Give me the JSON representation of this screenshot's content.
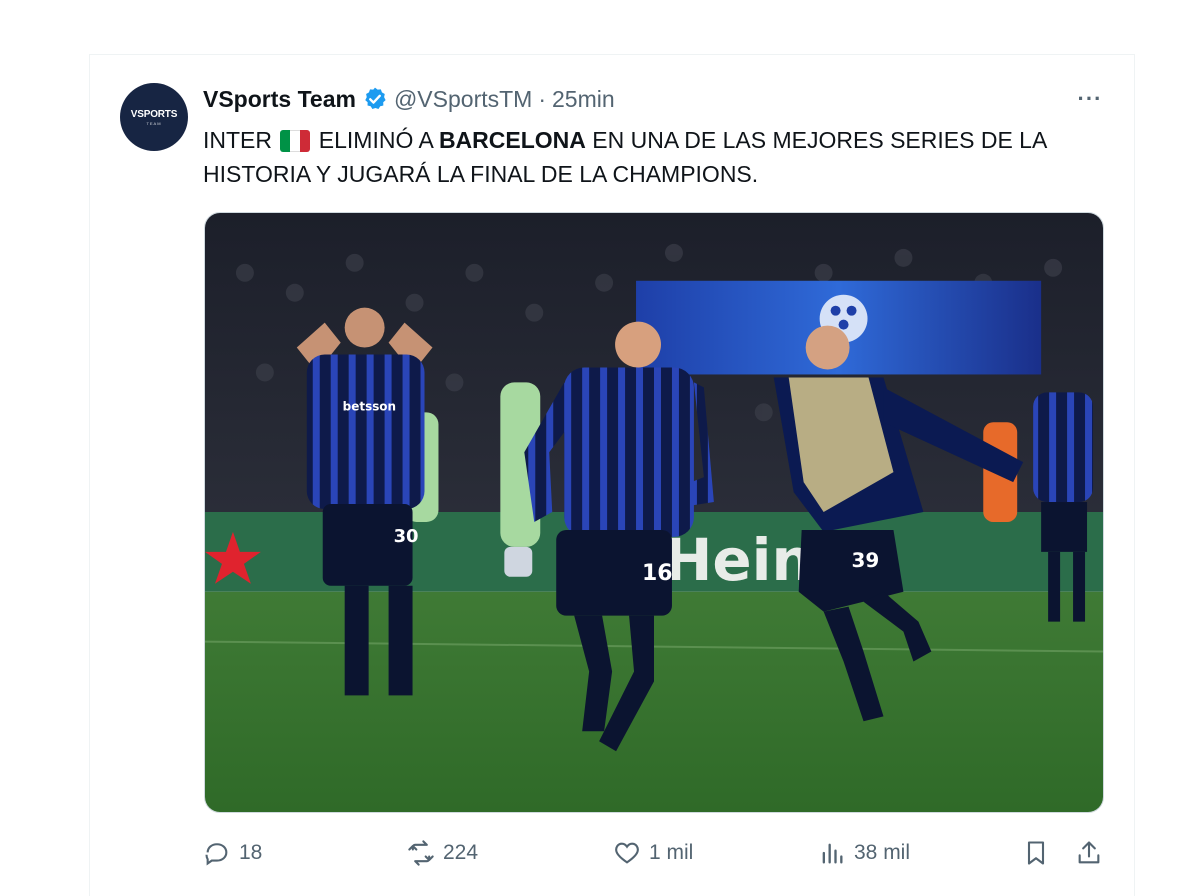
{
  "tweet": {
    "avatar_text": "VSPORTS",
    "avatar_subtext": "TEAM",
    "display_name": "VSports Team",
    "handle": "@VSportsTM",
    "separator": "·",
    "time": "25min",
    "more_label": "···",
    "text_part1": "INTER",
    "text_part2": "ELIMINÓ A",
    "text_bold": "BARCELONA",
    "text_part3": "EN UNA DE LAS MEJORES SERIES DE LA HISTORIA Y JUGARÁ LA FINAL DE LA CHAMPIONS.",
    "flag_colors": [
      "#009246",
      "#ffffff",
      "#ce2b37"
    ],
    "media": {
      "jersey_numbers": [
        "30",
        "16",
        "39"
      ],
      "sponsor_text": "betsson",
      "board_text": "Hein"
    }
  },
  "actions": {
    "replies": {
      "icon": "reply-icon",
      "count": "18"
    },
    "reposts": {
      "icon": "repost-icon",
      "count": "224"
    },
    "likes": {
      "icon": "heart-icon",
      "count": "1 mil"
    },
    "views": {
      "icon": "views-icon",
      "count": "38 mil"
    },
    "bookmark": {
      "icon": "bookmark-icon"
    },
    "share": {
      "icon": "share-icon"
    }
  },
  "colors": {
    "accent": "#1d9bf0",
    "muted": "#536471",
    "text": "#0f1419"
  }
}
